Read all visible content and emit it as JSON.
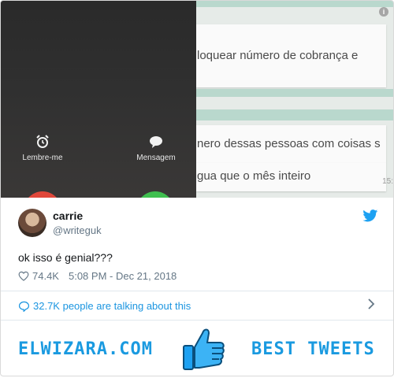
{
  "call_screen": {
    "remind_label": "Lembre-me",
    "message_label": "Mensagem",
    "remind_icon": "alarm-clock-icon",
    "message_icon": "speech-bubble-icon"
  },
  "chat_screenshot": {
    "line1": "loquear número de cobrança e",
    "line2": "nero dessas pessoas com coisas s",
    "line3": "gua que o mês inteiro",
    "time_fragment": "15:"
  },
  "tweet": {
    "display_name": "carrie",
    "handle": "@writeguk",
    "text": "ok isso é genial???",
    "likes": "74.4K",
    "timestamp": "5:08 PM - Dec 21, 2018",
    "talking": "32.7K people are talking about this"
  },
  "footer": {
    "left_brand": "ELWIZARA.COM",
    "right_brand": "BEST TWEETS"
  },
  "colors": {
    "twitter_blue": "#1da1f2",
    "link_blue": "#1b95e0",
    "brand_blue": "#1a9ae0",
    "decline_red": "#e0473a",
    "accept_green": "#3fbf4f"
  }
}
